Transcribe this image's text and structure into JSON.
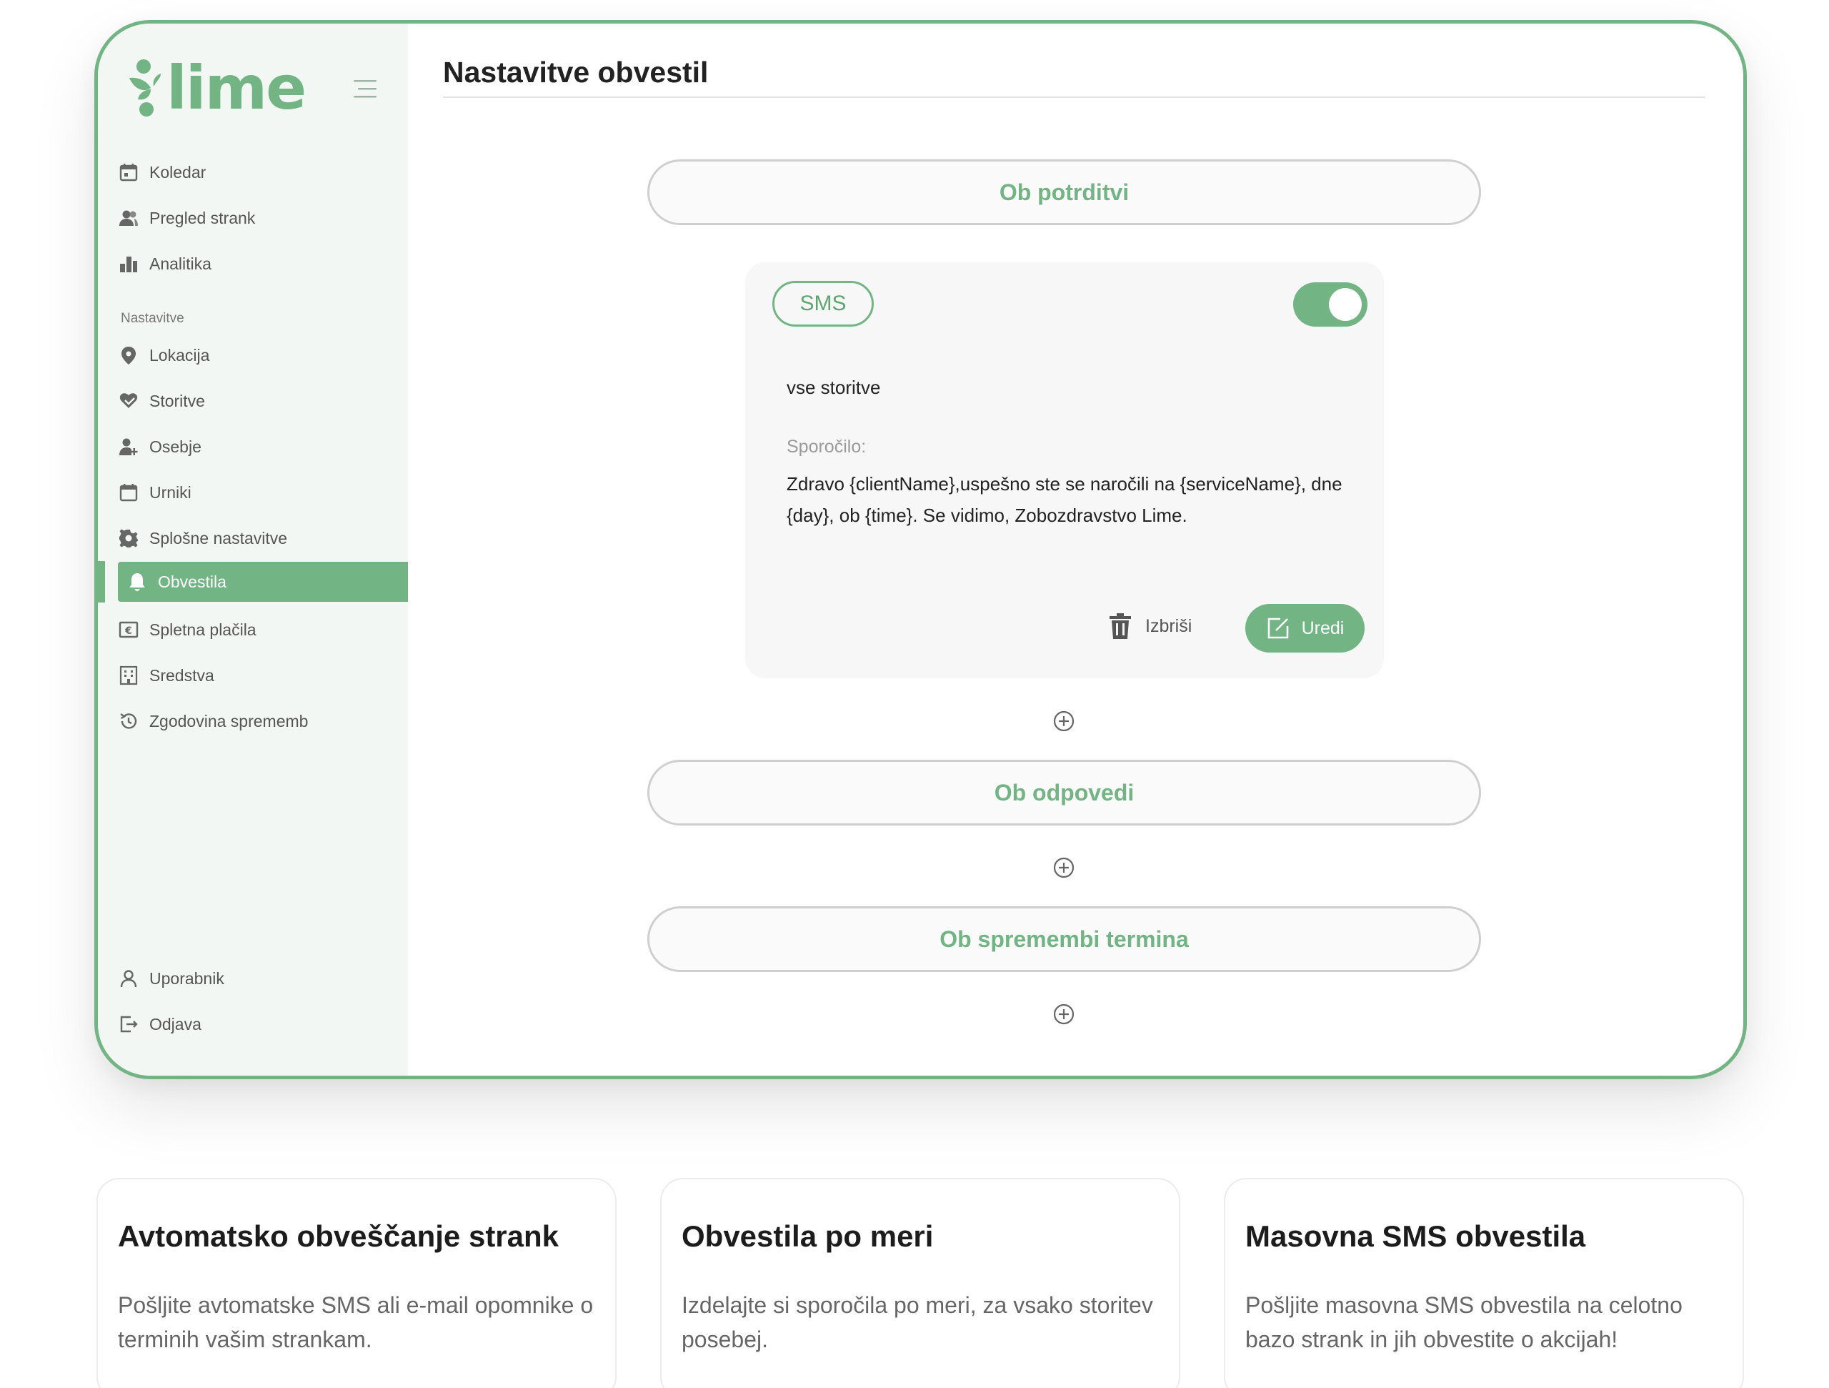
{
  "brand": {
    "name": "lime",
    "accent": "#72b483"
  },
  "sidebar": {
    "primary_items": [
      {
        "label": "Koledar",
        "icon": "calendar-icon"
      },
      {
        "label": "Pregled strank",
        "icon": "users-icon"
      },
      {
        "label": "Analitika",
        "icon": "bar-chart-icon"
      }
    ],
    "section_label": "Nastavitve",
    "settings_items": [
      {
        "label": "Lokacija",
        "icon": "location-pin-icon"
      },
      {
        "label": "Storitve",
        "icon": "heart-hand-icon"
      },
      {
        "label": "Osebje",
        "icon": "add-person-icon"
      },
      {
        "label": "Urniki",
        "icon": "calendar-icon"
      },
      {
        "label": "Splošne nastavitve",
        "icon": "gear-icon"
      },
      {
        "label": "Obvestila",
        "icon": "bell-icon",
        "active": true
      },
      {
        "label": "Spletna plačila",
        "icon": "euro-icon"
      },
      {
        "label": "Sredstva",
        "icon": "building-icon"
      },
      {
        "label": "Zgodovina sprememb",
        "icon": "history-icon"
      }
    ],
    "bottom_items": [
      {
        "label": "Uporabnik",
        "icon": "user-icon"
      },
      {
        "label": "Odjava",
        "icon": "logout-icon"
      }
    ]
  },
  "main": {
    "title": "Nastavitve obvestil",
    "triggers": [
      {
        "label": "Ob potrditvi"
      },
      {
        "label": "Ob odpovedi"
      },
      {
        "label": "Ob spremembi termina"
      }
    ],
    "notification_card": {
      "channel": "SMS",
      "enabled": true,
      "scope": "vse storitve",
      "message_label": "Sporočilo:",
      "message": "Zdravo {clientName},uspešno ste se naročili na {serviceName}, dne {day}, ob {time}. Se vidimo, Zobozdravstvo Lime.",
      "delete_label": "Izbriši",
      "edit_label": "Uredi"
    }
  },
  "features": [
    {
      "title": "Avtomatsko obveščanje strank",
      "text": "Pošljite avtomatske SMS ali e-mail opomnike o terminih vašim strankam."
    },
    {
      "title": "Obvestila po meri",
      "text": "Izdelajte si sporočila po meri, za vsako storitev posebej."
    },
    {
      "title": "Masovna SMS obvestila",
      "text": "Pošljite masovna SMS obvestila na celotno bazo strank in jih obvestite o akcijah!"
    }
  ]
}
